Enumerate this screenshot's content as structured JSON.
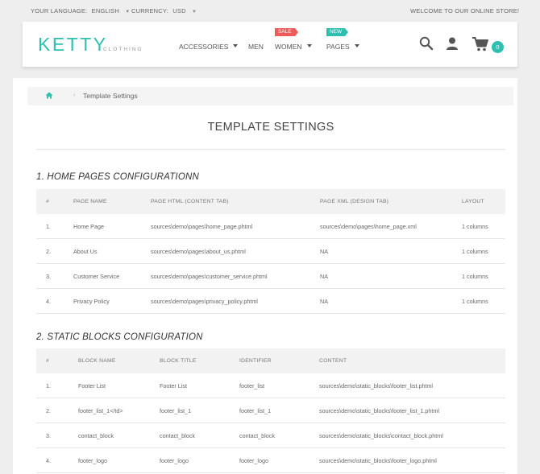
{
  "topbar": {
    "language_label": "YOUR LANGUAGE:",
    "language_value": "ENGLISH",
    "currency_label": "CURRENCY:",
    "currency_value": "USD",
    "welcome": "WELCOME TO OUR ONLINE STORE!"
  },
  "header": {
    "logo": "KETTY",
    "logo_sub": "CLOTHING",
    "nav": [
      {
        "label": "ACCESSORIES",
        "has_dropdown": true
      },
      {
        "label": "MEN",
        "has_dropdown": false
      },
      {
        "label": "WOMEN",
        "has_dropdown": true,
        "badge": "SALE"
      },
      {
        "label": "PAGES",
        "has_dropdown": true,
        "badge": "NEW"
      }
    ],
    "cart_count": "0",
    "icons": [
      "search-icon",
      "user-icon",
      "cart-icon"
    ],
    "colors": {
      "accent": "#2ebfb0",
      "sale": "#ef5a5a"
    }
  },
  "breadcrumb": {
    "current": "Template Settings"
  },
  "page_title": "TEMPLATE SETTINGS",
  "section1": {
    "title": "1. HOME PAGES CONFIGURATIONN",
    "headers": [
      "#",
      "PAGE NAME",
      "PAGE HTML (CONTENT TAB)",
      "PAGE XML (DESIGN TAB)",
      "LAYOUT"
    ],
    "rows": [
      [
        "1.",
        "Home Page",
        "sources\\demo\\pages\\home_page.phtml",
        "sources\\demo\\pages\\home_page.xml",
        "1 columns"
      ],
      [
        "2.",
        "About Us",
        "sources\\demo\\pages\\about_us.phtml",
        "NA",
        "1 columns"
      ],
      [
        "3.",
        "Customer Service",
        "sources\\demo\\pages\\customer_service.phtml",
        "NA",
        "1 columns"
      ],
      [
        "4.",
        "Privacy Policy",
        "sources\\demo\\pages\\privacy_policy.phtml",
        "NA",
        "1 columns"
      ]
    ]
  },
  "section2": {
    "title": "2. STATIC BLOCKS CONFIGURATION",
    "headers": [
      "#",
      "BLOCK NAME",
      "BLOCK TITLE",
      "IDENTIFIER",
      "CONTENT"
    ],
    "rows": [
      [
        "1.",
        "Footer List",
        "Footer List",
        "footer_list",
        "sources\\demo\\static_blocks\\footer_list.phtml"
      ],
      [
        "2.",
        "footer_list_1</td>",
        "footer_list_1",
        "footer_list_1",
        "sources\\demo\\static_blocks\\footer_list_1.phtml"
      ],
      [
        "3.",
        "contact_block",
        "contact_block",
        "contact_block",
        "sources\\demo\\static_blocks\\contact_block.phtml"
      ],
      [
        "4.",
        "footer_logo",
        "footer_logo",
        "footer_logo",
        "sources\\demo\\static_blocks\\footer_logo.phtml"
      ]
    ]
  }
}
